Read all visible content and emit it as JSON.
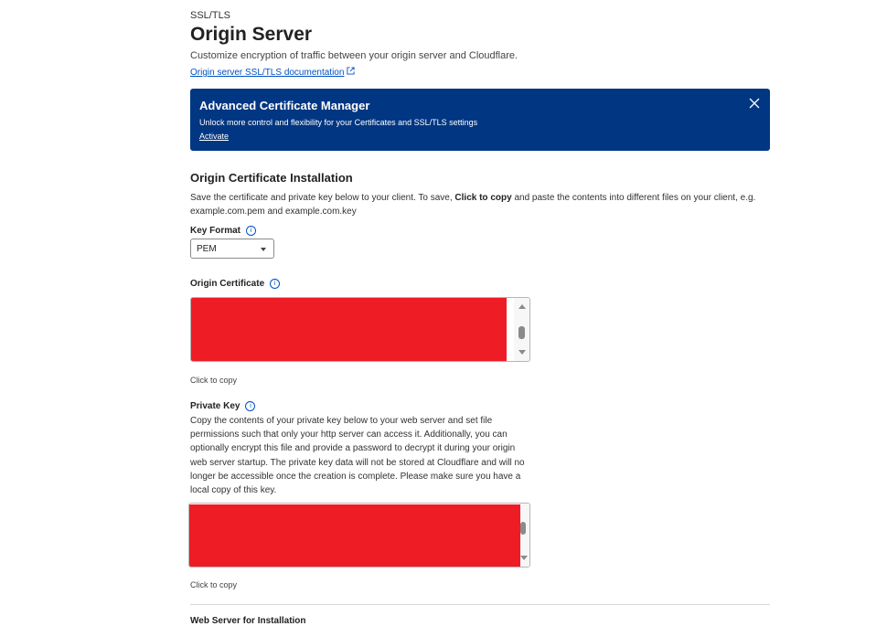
{
  "breadcrumb": "SSL/TLS",
  "page": {
    "title": "Origin Server",
    "subtitle": "Customize encryption of traffic between your origin server and Cloudflare.",
    "doc_link": "Origin server SSL/TLS documentation"
  },
  "banner": {
    "title": "Advanced Certificate Manager",
    "text": "Unlock more control and flexibility for your Certificates and SSL/TLS settings",
    "link": "Activate",
    "color": "#003682"
  },
  "installation": {
    "title": "Origin Certificate Installation",
    "desc_before": "Save the certificate and private key below to your client. To save, ",
    "desc_bold": "Click to copy",
    "desc_after": " and paste the contents into different files on your client, e.g. example.com.pem and example.com.key"
  },
  "key_format": {
    "label": "Key Format",
    "selected": "PEM"
  },
  "origin_certificate": {
    "label": "Origin Certificate",
    "copy_hint": "Click to copy"
  },
  "private_key": {
    "label": "Private Key",
    "desc": "Copy the contents of your private key below to your web server and set file permissions such that only your http server can access it. Additionally, you can optionally encrypt this file and provide a password to decrypt it during your origin web server startup. The private key data will not be stored at Cloudflare and will no longer be accessible once the creation is complete. Please make sure you have a local copy of this key.",
    "copy_hint": "Click to copy"
  },
  "web_server": {
    "label": "Web Server for Installation"
  },
  "colors": {
    "link": "#0051c3",
    "redaction": "#ee1c25"
  }
}
